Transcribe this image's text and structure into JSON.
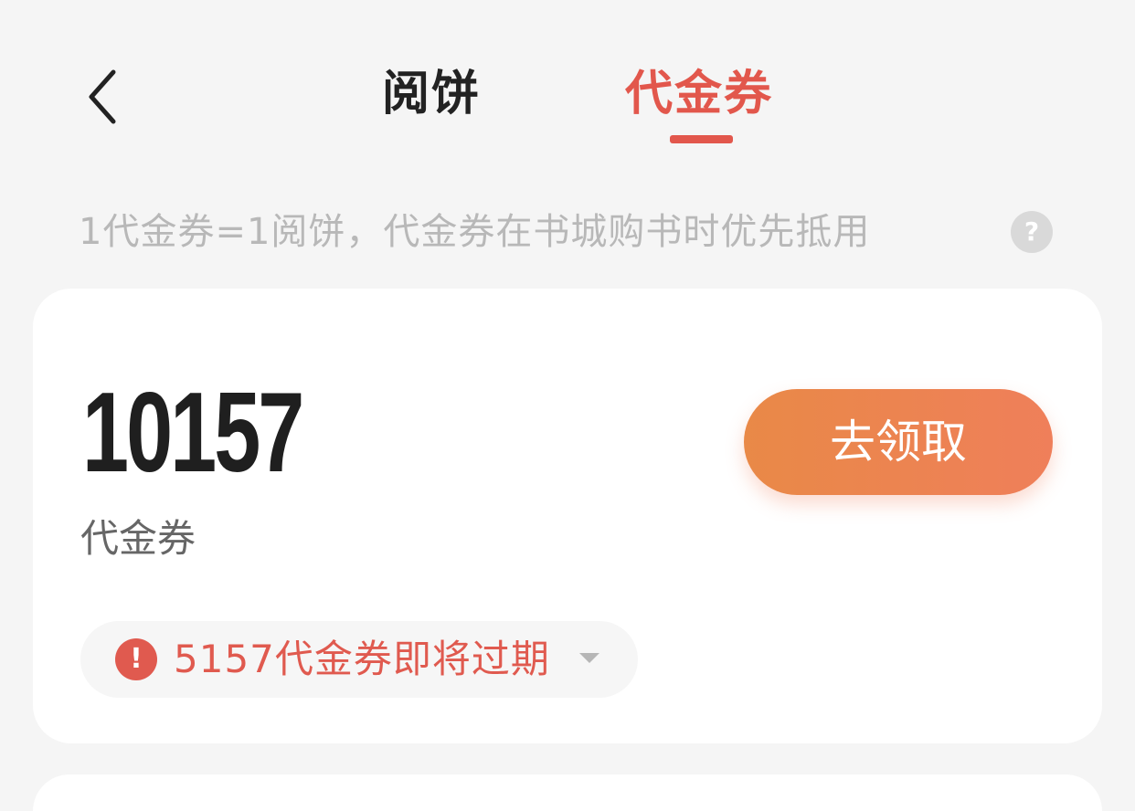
{
  "header": {
    "back_icon": "chevron-left-icon",
    "tabs": [
      {
        "label": "阅饼",
        "selected": false
      },
      {
        "label": "代金券",
        "selected": true
      }
    ],
    "accent_color": "#e2574c"
  },
  "info": {
    "text": "1代金券=1阅饼，代金券在书城购书时优先抵用",
    "help_icon": "question-icon",
    "help_symbol": "?"
  },
  "voucher_card": {
    "amount": "10157",
    "unit_label": "代金券",
    "claim_button": "去领取",
    "expiry_notice": {
      "icon": "alert-icon",
      "icon_symbol": "!",
      "text": "5157代金券即将过期",
      "dropdown_icon": "caret-down-icon",
      "color": "#e05a4f"
    }
  }
}
